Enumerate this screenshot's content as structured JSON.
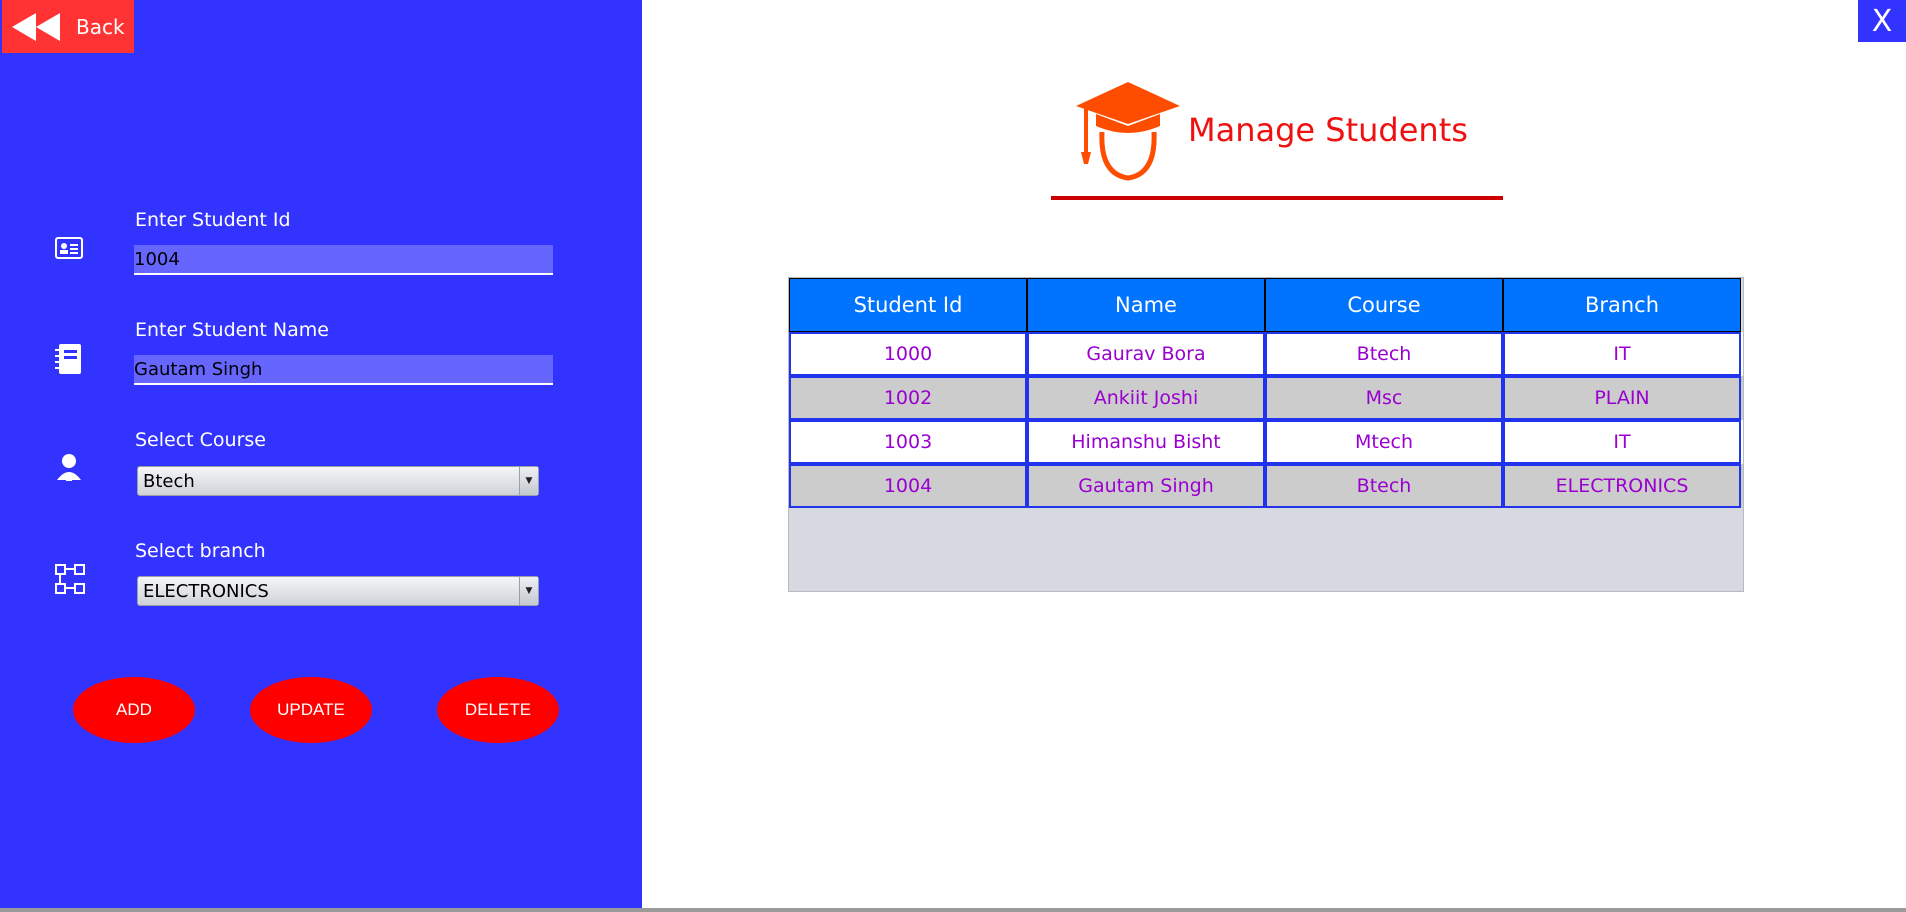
{
  "window": {
    "close_label": "X"
  },
  "back": {
    "label": "Back"
  },
  "form": {
    "student_id": {
      "label": "Enter Student Id",
      "value": "1004"
    },
    "student_name": {
      "label": "Enter Student Name",
      "value": "Gautam Singh"
    },
    "course": {
      "label": "Select Course",
      "selected": "Btech"
    },
    "branch": {
      "label": "Select branch",
      "selected": "ELECTRONICS"
    }
  },
  "buttons": {
    "add": "ADD",
    "update": "UPDATE",
    "delete": "DELETE"
  },
  "header": {
    "title": "Manage Students"
  },
  "table": {
    "columns": [
      "Student Id",
      "Name",
      "Course",
      "Branch"
    ],
    "rows": [
      [
        "1000",
        "Gaurav Bora",
        "Btech",
        "IT"
      ],
      [
        "1002",
        "Ankiit Joshi",
        "Msc",
        "PLAIN"
      ],
      [
        "1003",
        "Himanshu Bisht",
        "Mtech",
        "IT"
      ],
      [
        "1004",
        "Gautam Singh",
        "Btech",
        "ELECTRONICS"
      ]
    ]
  },
  "colors": {
    "panel": "#3333ff",
    "accent_red": "#ff0000",
    "table_header": "#0073ff",
    "cell_text": "#9a00d0",
    "row_alt": "#cccccc"
  }
}
